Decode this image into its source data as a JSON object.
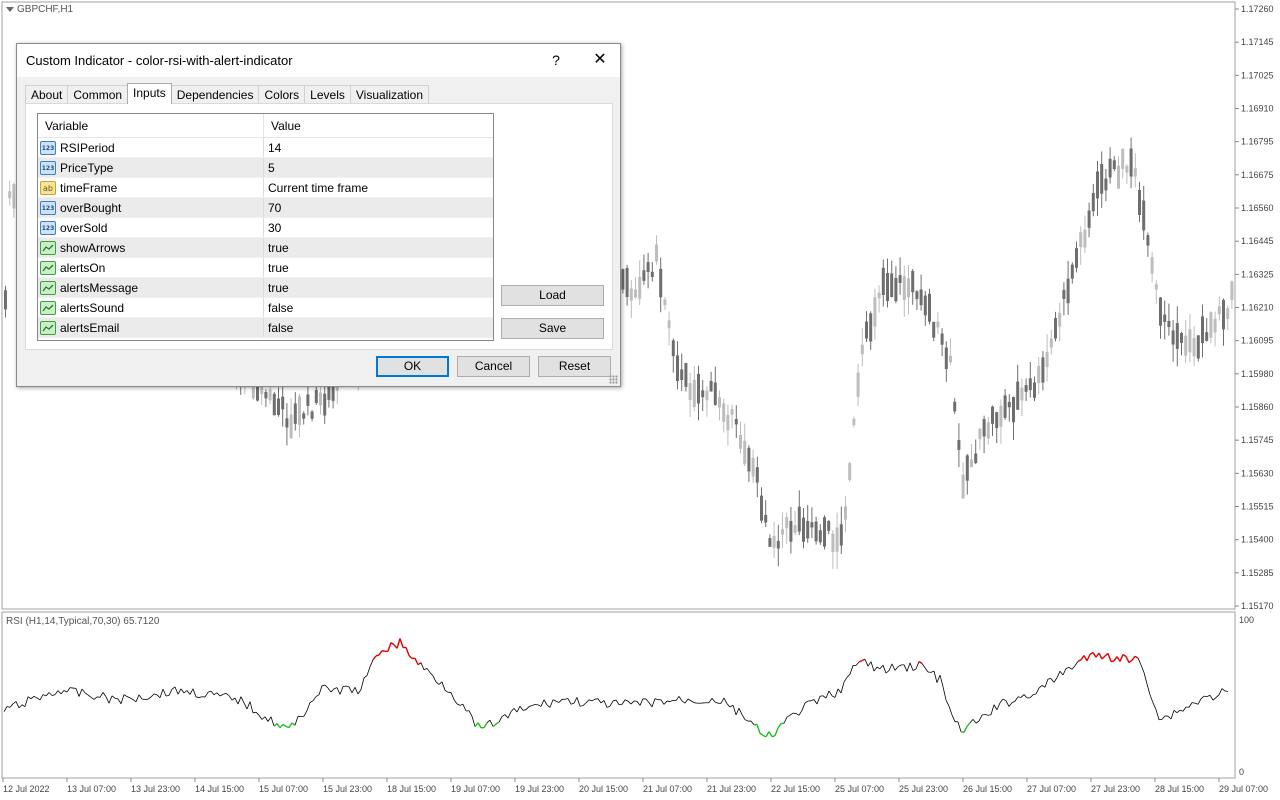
{
  "chart": {
    "symbol": "GBPCHF,H1",
    "rsi_label": "RSI (H1,14,Typical,70,30) 65.7120",
    "price_axis": [
      "1.17260",
      "1.17145",
      "1.17025",
      "1.16910",
      "1.16795",
      "1.16675",
      "1.16560",
      "1.16445",
      "1.16325",
      "1.16210",
      "1.16095",
      "1.15980",
      "1.15860",
      "1.15745",
      "1.15630",
      "1.15515",
      "1.15400",
      "1.15285",
      "1.15170"
    ],
    "rsi_axis": [
      "100",
      "0"
    ],
    "time_axis": [
      "12 Jul 2022",
      "13 Jul 07:00",
      "13 Jul 23:00",
      "14 Jul 15:00",
      "15 Jul 07:00",
      "15 Jul 23:00",
      "18 Jul 15:00",
      "19 Jul 07:00",
      "19 Jul 23:00",
      "20 Jul 15:00",
      "21 Jul 07:00",
      "21 Jul 23:00",
      "22 Jul 15:00",
      "25 Jul 07:00",
      "25 Jul 23:00",
      "26 Jul 15:00",
      "27 Jul 07:00",
      "27 Jul 23:00",
      "28 Jul 15:00",
      "29 Jul 07:00"
    ],
    "colors": {
      "bull": "#bdbdbd",
      "bear": "#6e6e6e",
      "rsi": "#000000",
      "overbought": "#e00000",
      "oversold": "#22bb22"
    }
  },
  "dialog": {
    "title": "Custom Indicator - color-rsi-with-alert-indicator",
    "help": "?",
    "close": "✕",
    "tabs": [
      {
        "label": "About"
      },
      {
        "label": "Common"
      },
      {
        "label": "Inputs"
      },
      {
        "label": "Dependencies"
      },
      {
        "label": "Colors"
      },
      {
        "label": "Levels"
      },
      {
        "label": "Visualization"
      }
    ],
    "active_tab": "Inputs",
    "grid": {
      "headers": {
        "variable": "Variable",
        "value": "Value"
      },
      "rows": [
        {
          "name": "RSIPeriod",
          "value": "14",
          "icon": "numeric-icon",
          "glyph": "123"
        },
        {
          "name": "PriceType",
          "value": "5",
          "icon": "numeric-icon",
          "glyph": "123"
        },
        {
          "name": "timeFrame",
          "value": "Current time frame",
          "icon": "string-icon",
          "glyph": "ab"
        },
        {
          "name": "overBought",
          "value": "70",
          "icon": "numeric-icon",
          "glyph": "123"
        },
        {
          "name": "overSold",
          "value": "30",
          "icon": "numeric-icon",
          "glyph": "123"
        },
        {
          "name": "showArrows",
          "value": "true",
          "icon": "boolean-icon",
          "glyph": ""
        },
        {
          "name": "alertsOn",
          "value": "true",
          "icon": "boolean-icon",
          "glyph": ""
        },
        {
          "name": "alertsMessage",
          "value": "true",
          "icon": "boolean-icon",
          "glyph": ""
        },
        {
          "name": "alertsSound",
          "value": "false",
          "icon": "boolean-icon",
          "glyph": ""
        },
        {
          "name": "alertsEmail",
          "value": "false",
          "icon": "boolean-icon",
          "glyph": ""
        }
      ]
    },
    "buttons": {
      "load": "Load",
      "save": "Save",
      "ok": "OK",
      "cancel": "Cancel",
      "reset": "Reset"
    }
  }
}
